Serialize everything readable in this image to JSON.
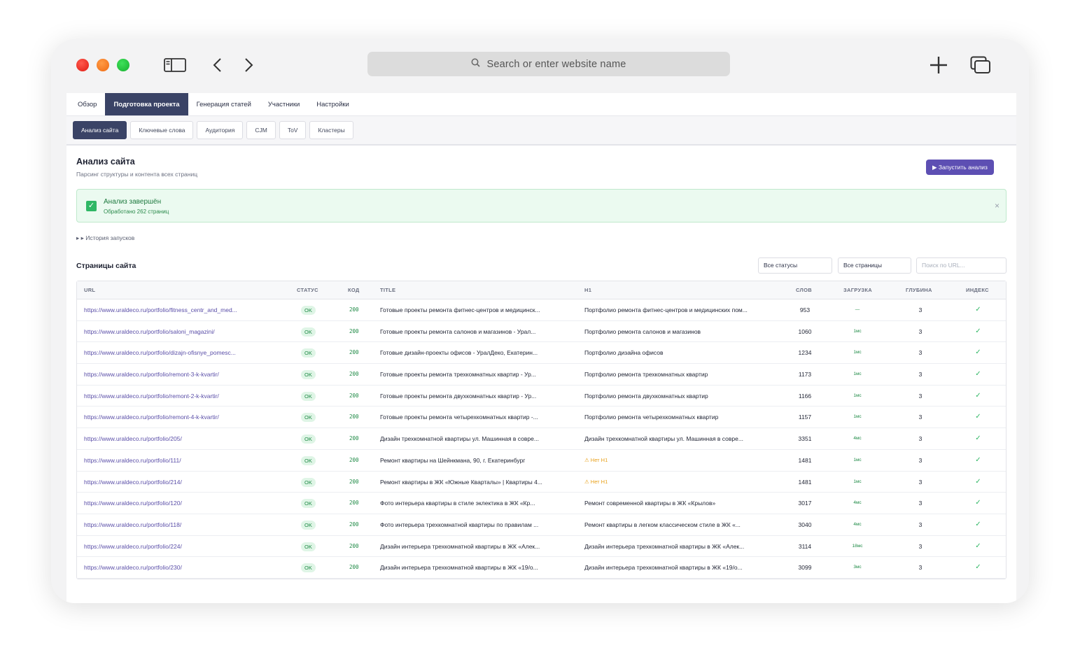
{
  "browser": {
    "address_placeholder": "Search or enter website name"
  },
  "tabs": [
    {
      "label": "Обзор",
      "active": false
    },
    {
      "label": "Подготовка проекта",
      "active": true
    },
    {
      "label": "Генерация статей",
      "active": false
    },
    {
      "label": "Участники",
      "active": false
    },
    {
      "label": "Настройки",
      "active": false
    }
  ],
  "subtabs": [
    {
      "label": "Анализ сайта",
      "active": true
    },
    {
      "label": "Ключевые слова",
      "active": false
    },
    {
      "label": "Аудитория",
      "active": false
    },
    {
      "label": "CJM",
      "active": false
    },
    {
      "label": "ToV",
      "active": false
    },
    {
      "label": "Кластеры",
      "active": false
    }
  ],
  "section": {
    "title": "Анализ сайта",
    "subtitle": "Парсинг структуры и контента всех страниц",
    "run_button": "▶ Запустить анализ"
  },
  "alert": {
    "title": "Анализ завершён",
    "subtitle": "Обработано 262 страниц",
    "close": "×"
  },
  "history_label": "▸ ▸ История запусков",
  "pages": {
    "title": "Страницы сайта",
    "status_filter": "Все статусы",
    "pages_filter": "Все страницы",
    "search_placeholder": "Поиск по URL..."
  },
  "table": {
    "columns": [
      "URL",
      "СТАТУС",
      "КОД",
      "TITLE",
      "H1",
      "СЛОВ",
      "ЗАГРУЗКА",
      "ГЛУБИНА",
      "ИНДЕКС"
    ],
    "rows": [
      {
        "url": "https://www.uraldeco.ru/portfolio/fitness_centr_and_med...",
        "status": "OK",
        "code": "200",
        "title": "Готовые проекты ремонта фитнес-центров и медицинск...",
        "h1": "Портфолио ремонта фитнес-центров и медицинских пом...",
        "h1_warn": false,
        "words": "953",
        "load": "—",
        "depth": "3",
        "index": "✓"
      },
      {
        "url": "https://www.uraldeco.ru/portfolio/saloni_magazini/",
        "status": "OK",
        "code": "200",
        "title": "Готовые проекты ремонта салонов и магазинов - Урал...",
        "h1": "Портфолио ремонта салонов и магазинов",
        "h1_warn": false,
        "words": "1060",
        "load": "1мс",
        "depth": "3",
        "index": "✓"
      },
      {
        "url": "https://www.uraldeco.ru/portfolio/dizajn-ofisnye_pomesc...",
        "status": "OK",
        "code": "200",
        "title": "Готовые дизайн-проекты офисов - УралДеко, Екатерин...",
        "h1": "Портфолио дизайна офисов",
        "h1_warn": false,
        "words": "1234",
        "load": "1мс",
        "depth": "3",
        "index": "✓"
      },
      {
        "url": "https://www.uraldeco.ru/portfolio/remont-3-k-kvartir/",
        "status": "OK",
        "code": "200",
        "title": "Готовые проекты ремонта трехкомнатных квартир - Ур...",
        "h1": "Портфолио ремонта трехкомнатных квартир",
        "h1_warn": false,
        "words": "1173",
        "load": "1мс",
        "depth": "3",
        "index": "✓"
      },
      {
        "url": "https://www.uraldeco.ru/portfolio/remont-2-k-kvartir/",
        "status": "OK",
        "code": "200",
        "title": "Готовые проекты ремонта двухкомнатных квартир - Ур...",
        "h1": "Портфолио ремонта двухкомнатных квартир",
        "h1_warn": false,
        "words": "1166",
        "load": "1мс",
        "depth": "3",
        "index": "✓"
      },
      {
        "url": "https://www.uraldeco.ru/portfolio/remont-4-k-kvartir/",
        "status": "OK",
        "code": "200",
        "title": "Готовые проекты ремонта четырехкомнатных квартир -...",
        "h1": "Портфолио ремонта четырехкомнатных квартир",
        "h1_warn": false,
        "words": "1157",
        "load": "1мс",
        "depth": "3",
        "index": "✓"
      },
      {
        "url": "https://www.uraldeco.ru/portfolio/205/",
        "status": "OK",
        "code": "200",
        "title": "Дизайн трехкомнатной квартиры ул. Машинная в совре...",
        "h1": "Дизайн трехкомнатной квартиры ул. Машинная в совре...",
        "h1_warn": false,
        "words": "3351",
        "load": "4мс",
        "depth": "3",
        "index": "✓"
      },
      {
        "url": "https://www.uraldeco.ru/portfolio/111/",
        "status": "OK",
        "code": "200",
        "title": "Ремонт квартиры на Шейнкмана, 90, г. Екатеринбург",
        "h1": "⚠ Нет H1",
        "h1_warn": true,
        "words": "1481",
        "load": "1мс",
        "depth": "3",
        "index": "✓"
      },
      {
        "url": "https://www.uraldeco.ru/portfolio/214/",
        "status": "OK",
        "code": "200",
        "title": "Ремонт квартиры в ЖК «Южные Кварталы» | Квартиры 4...",
        "h1": "⚠ Нет H1",
        "h1_warn": true,
        "words": "1481",
        "load": "1мс",
        "depth": "3",
        "index": "✓"
      },
      {
        "url": "https://www.uraldeco.ru/portfolio/120/",
        "status": "OK",
        "code": "200",
        "title": "Фото интерьера квартиры в стиле эклектика в ЖК «Кр...",
        "h1": "Ремонт современной квартиры в ЖК «Крылов»",
        "h1_warn": false,
        "words": "3017",
        "load": "4мс",
        "depth": "3",
        "index": "✓"
      },
      {
        "url": "https://www.uraldeco.ru/portfolio/118/",
        "status": "OK",
        "code": "200",
        "title": "Фото интерьера трехкомнатной квартиры по правилам ...",
        "h1": "Ремонт квартиры в легком классическом стиле в ЖК «...",
        "h1_warn": false,
        "words": "3040",
        "load": "4мс",
        "depth": "3",
        "index": "✓"
      },
      {
        "url": "https://www.uraldeco.ru/portfolio/224/",
        "status": "OK",
        "code": "200",
        "title": "Дизайн интерьера трехкомнатной квартиры в ЖК «Алек...",
        "h1": "Дизайн интерьера трехкомнатной квартиры в ЖК «Алек...",
        "h1_warn": false,
        "words": "3114",
        "load": "18мс",
        "depth": "3",
        "index": "✓"
      },
      {
        "url": "https://www.uraldeco.ru/portfolio/230/",
        "status": "OK",
        "code": "200",
        "title": "Дизайн интерьера трехкомнатной квартиры в ЖК «19/о...",
        "h1": "Дизайн интерьера трехкомнатной квартиры в ЖК «19/о...",
        "h1_warn": false,
        "words": "3099",
        "load": "3мс",
        "depth": "3",
        "index": "✓"
      }
    ]
  }
}
